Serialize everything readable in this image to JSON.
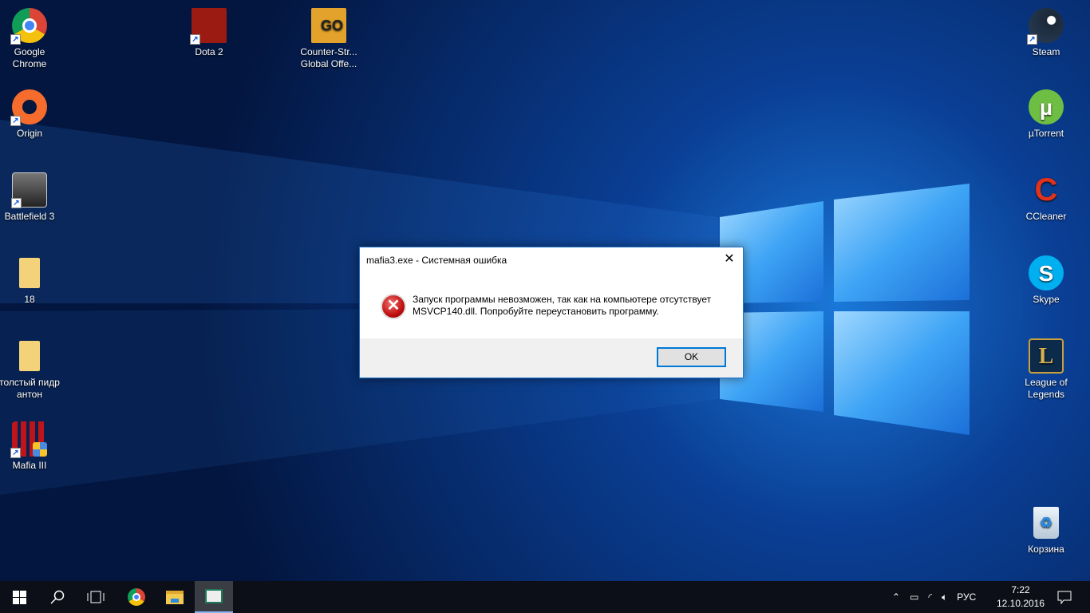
{
  "desktop": {
    "icons": [
      {
        "label": "Google Chrome",
        "icon": "chrome-icon"
      },
      {
        "label": "Origin",
        "icon": "origin-icon"
      },
      {
        "label": "Battlefield 3",
        "icon": "battlefield-icon"
      },
      {
        "label": "18",
        "icon": "folder-icon"
      },
      {
        "label": "толстый пидр антон",
        "icon": "folder-icon"
      },
      {
        "label": "Mafia III",
        "icon": "mafia-icon"
      },
      {
        "label": "Dota 2",
        "icon": "dota-icon"
      },
      {
        "label": "Counter-Str... Global Offe...",
        "icon": "csgo-icon",
        "glyph": "GO"
      },
      {
        "label": "Steam",
        "icon": "steam-icon"
      },
      {
        "label": "µTorrent",
        "icon": "utorrent-icon",
        "glyph": "µ"
      },
      {
        "label": "CCleaner",
        "icon": "ccleaner-icon",
        "glyph": "C"
      },
      {
        "label": "Skype",
        "icon": "skype-icon",
        "glyph": "S"
      },
      {
        "label": "League of Legends",
        "icon": "lol-icon",
        "glyph": "L"
      },
      {
        "label": "Корзина",
        "icon": "recycle-bin-icon"
      }
    ]
  },
  "dialog": {
    "title": "mafia3.exe - Системная ошибка",
    "message_line1": "Запуск программы невозможен, так как на компьютере отсутствует",
    "message_line2": "MSVCP140.dll. Попробуйте переустановить программу.",
    "ok": "OK",
    "close": "✕"
  },
  "taskbar": {
    "language": "РУС",
    "time": "7:22",
    "date": "12.10.2016"
  }
}
